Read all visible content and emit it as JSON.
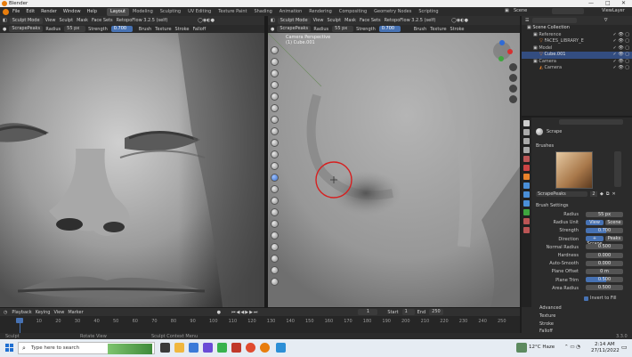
{
  "window": {
    "title": "Blender",
    "controls": [
      "—",
      "□",
      "✕"
    ]
  },
  "menu": {
    "items": [
      "File",
      "Edit",
      "Render",
      "Window",
      "Help"
    ],
    "workspaces": [
      "Layout",
      "Modeling",
      "Sculpting",
      "UV Editing",
      "Texture Paint",
      "Shading",
      "Animation",
      "Rendering",
      "Compositing",
      "Geometry Nodes",
      "Scripting"
    ],
    "active_workspace": "Layout",
    "scene": "Scene",
    "view_layer": "ViewLayer"
  },
  "left_editor": {
    "mode": "Sculpt Mode",
    "menus": [
      "View",
      "Sculpt",
      "Mask",
      "Face Sets"
    ],
    "addon": "RetopoFlow 3.2.5 (self)",
    "brush_name": "ScrapePeaks",
    "radius_label": "Radius",
    "radius_value": "55 px",
    "strength_label": "Strength",
    "strength_value": "0.700",
    "dropdowns": [
      "Brush",
      "Texture",
      "Stroke",
      "Falloff"
    ]
  },
  "right_editor": {
    "mode": "Sculpt Mode",
    "menus": [
      "View",
      "Sculpt",
      "Mask",
      "Face Sets"
    ],
    "addon": "RetopoFlow 3.2.5 (self)",
    "brush_name": "ScrapePeaks",
    "radius_label": "Radius",
    "radius_value": "55 px",
    "strength_label": "Strength",
    "strength_value": "0.700",
    "dropdowns": [
      "Brush",
      "Texture",
      "Stroke"
    ],
    "overlay_line1": "Camera Perspective",
    "overlay_line2": "(1) Cube.001"
  },
  "outliner": {
    "rows": [
      {
        "label": "Scene Collection",
        "indent": 0,
        "selected": false
      },
      {
        "label": "Reference",
        "indent": 1,
        "selected": false
      },
      {
        "label": "FACES_LIBRARY_E",
        "indent": 2,
        "selected": false
      },
      {
        "label": "Model",
        "indent": 1,
        "selected": false
      },
      {
        "label": "Cube.001",
        "indent": 2,
        "selected": true
      },
      {
        "label": "Camera",
        "indent": 1,
        "selected": false
      },
      {
        "label": "Camera",
        "indent": 2,
        "selected": false
      }
    ]
  },
  "properties": {
    "search_placeholder": "",
    "tool_name": "Scrape",
    "brushes_header": "Brushes",
    "brush_name": "ScrapePeaks",
    "brush_users": "2",
    "settings_header": "Brush Settings",
    "rows": [
      {
        "label": "Radius",
        "value": "55 px"
      },
      {
        "label": "Radius Unit",
        "value": "View",
        "value2": "Scene"
      },
      {
        "label": "Strength",
        "value": "0.700"
      },
      {
        "label": "Direction",
        "value": "+ Scrape",
        "value2": "Peaks"
      },
      {
        "label": "Normal Radius",
        "value": "0.500"
      },
      {
        "label": "Hardness",
        "value": "0.000"
      },
      {
        "label": "Auto-Smooth",
        "value": "0.000"
      },
      {
        "label": "Plane Offset",
        "value": "0 m"
      },
      {
        "label": "Plane Trim",
        "value": "0.500"
      },
      {
        "label": "Area Radius",
        "value": "0.500"
      }
    ],
    "invert_checkbox": "Invert to Fill",
    "collapsed_sections": [
      "Advanced",
      "Texture",
      "Stroke",
      "Falloff"
    ]
  },
  "timeline": {
    "menus": [
      "Playback",
      "Keying",
      "View",
      "Marker"
    ],
    "current_frame": "1",
    "start_label": "Start",
    "start_value": "1",
    "end_label": "End",
    "end_value": "250",
    "ticks": [
      "0",
      "10",
      "20",
      "30",
      "40",
      "50",
      "60",
      "70",
      "80",
      "90",
      "100",
      "110",
      "120",
      "130",
      "140",
      "150",
      "160",
      "170",
      "180",
      "190",
      "200",
      "210",
      "220",
      "230",
      "240",
      "250"
    ]
  },
  "statusbar": {
    "left": "Sculpt",
    "mid1": "Rotate View",
    "mid2": "Sculpt Context Menu",
    "version": "3.3.0"
  },
  "taskbar": {
    "search_placeholder": "Type here to search",
    "weather": "12°C Haze",
    "time": "2:14 AM",
    "date": "27/11/2022"
  },
  "colors": {
    "accent": "#4772b3",
    "selection": "#334d80",
    "brush_circle": "#d62020"
  }
}
